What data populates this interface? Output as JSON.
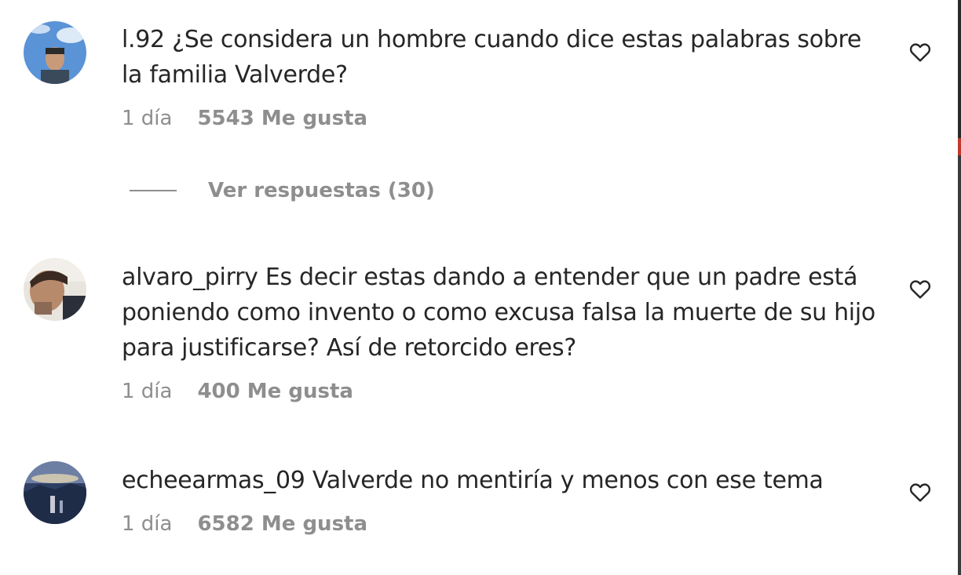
{
  "comments": [
    {
      "username": "l.92",
      "text": "¿Se considera un hombre cuando dice estas palabras sobre la familia Valverde?",
      "time": "1 día",
      "likes": "5543 Me gusta",
      "replies_label": "Ver respuestas (30)",
      "avatar_icon": "avatar-sky-person"
    },
    {
      "username": "alvaro_pirry",
      "text": "Es decir estas dando a entender que un padre está poniendo como invento o como excusa falsa la muerte de su hijo para justificarse? Así de retorcido eres?",
      "time": "1 día",
      "likes": "400 Me gusta",
      "avatar_icon": "avatar-selfie"
    },
    {
      "username": "echeearmas_09",
      "text": "Valverde no mentiría y menos con ese tema",
      "time": "1 día",
      "likes": "6582 Me gusta",
      "avatar_icon": "avatar-landscape"
    }
  ],
  "colors": {
    "text": "#262626",
    "muted": "#8e8e8e",
    "background": "#ffffff"
  }
}
